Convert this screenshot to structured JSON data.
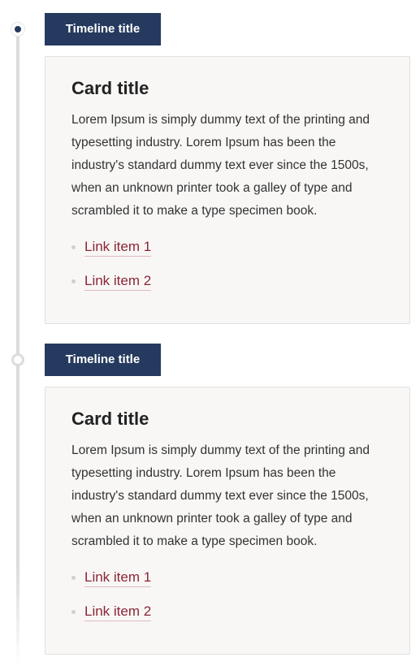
{
  "timeline": {
    "items": [
      {
        "tag": "Timeline title",
        "marker_state": "active",
        "card": {
          "title": "Card title",
          "body": "Lorem Ipsum is simply dummy text of the printing and typesetting industry. Lorem Ipsum has been the industry's standard dummy text ever since the 1500s, when an unknown printer took a galley of type and scrambled it to make a type specimen book.",
          "links": [
            "Link item 1",
            "Link item 2"
          ]
        }
      },
      {
        "tag": "Timeline title",
        "marker_state": "inactive",
        "card": {
          "title": "Card title",
          "body": "Lorem Ipsum is simply dummy text of the printing and typesetting industry. Lorem Ipsum has been the industry's standard dummy text ever since the 1500s, when an unknown printer took a galley of type and scrambled it to make a type specimen book.",
          "links": [
            "Link item 1",
            "Link item 2"
          ]
        }
      }
    ]
  },
  "colors": {
    "tag_background": "#253a5e",
    "link": "#8b2635",
    "card_background": "#f8f7f6",
    "line": "#dcdcdc"
  }
}
